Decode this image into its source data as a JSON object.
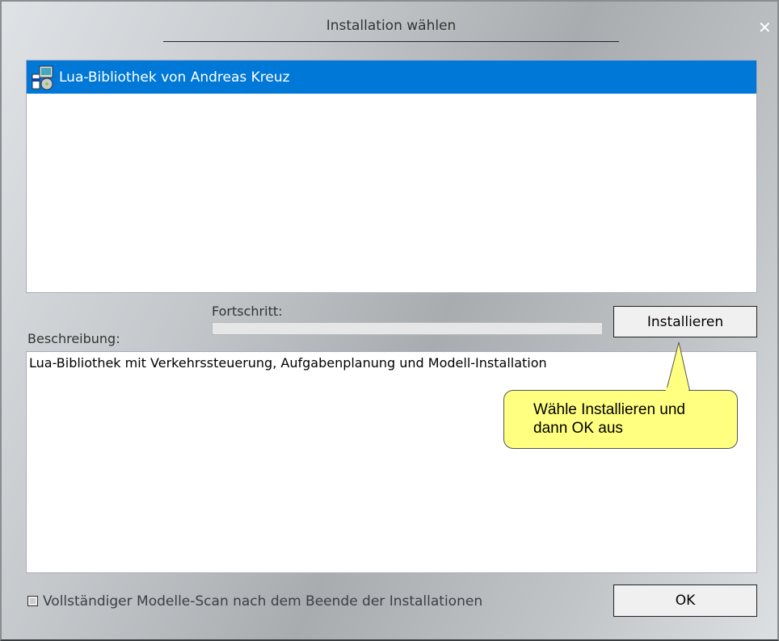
{
  "window": {
    "title": "Installation wählen",
    "close_glyph": "✕"
  },
  "list": {
    "items": [
      {
        "label": "Lua-Bibliothek von Andreas Kreuz",
        "icon": "installer-icon",
        "selected": true
      }
    ]
  },
  "progress": {
    "label": "Fortschritt:",
    "value": 0
  },
  "install_button": "Installieren",
  "description": {
    "label": "Beschreibung:",
    "text": "Lua-Bibliothek mit Verkehrssteuerung, Aufgabenplanung und Modell-Installation"
  },
  "tooltip": {
    "line1": "Wähle Installieren und",
    "line2": "dann OK aus"
  },
  "checkbox": {
    "label": "Vollständiger Modelle-Scan nach dem Beende der Installationen",
    "checked": false
  },
  "ok_button": "OK"
}
